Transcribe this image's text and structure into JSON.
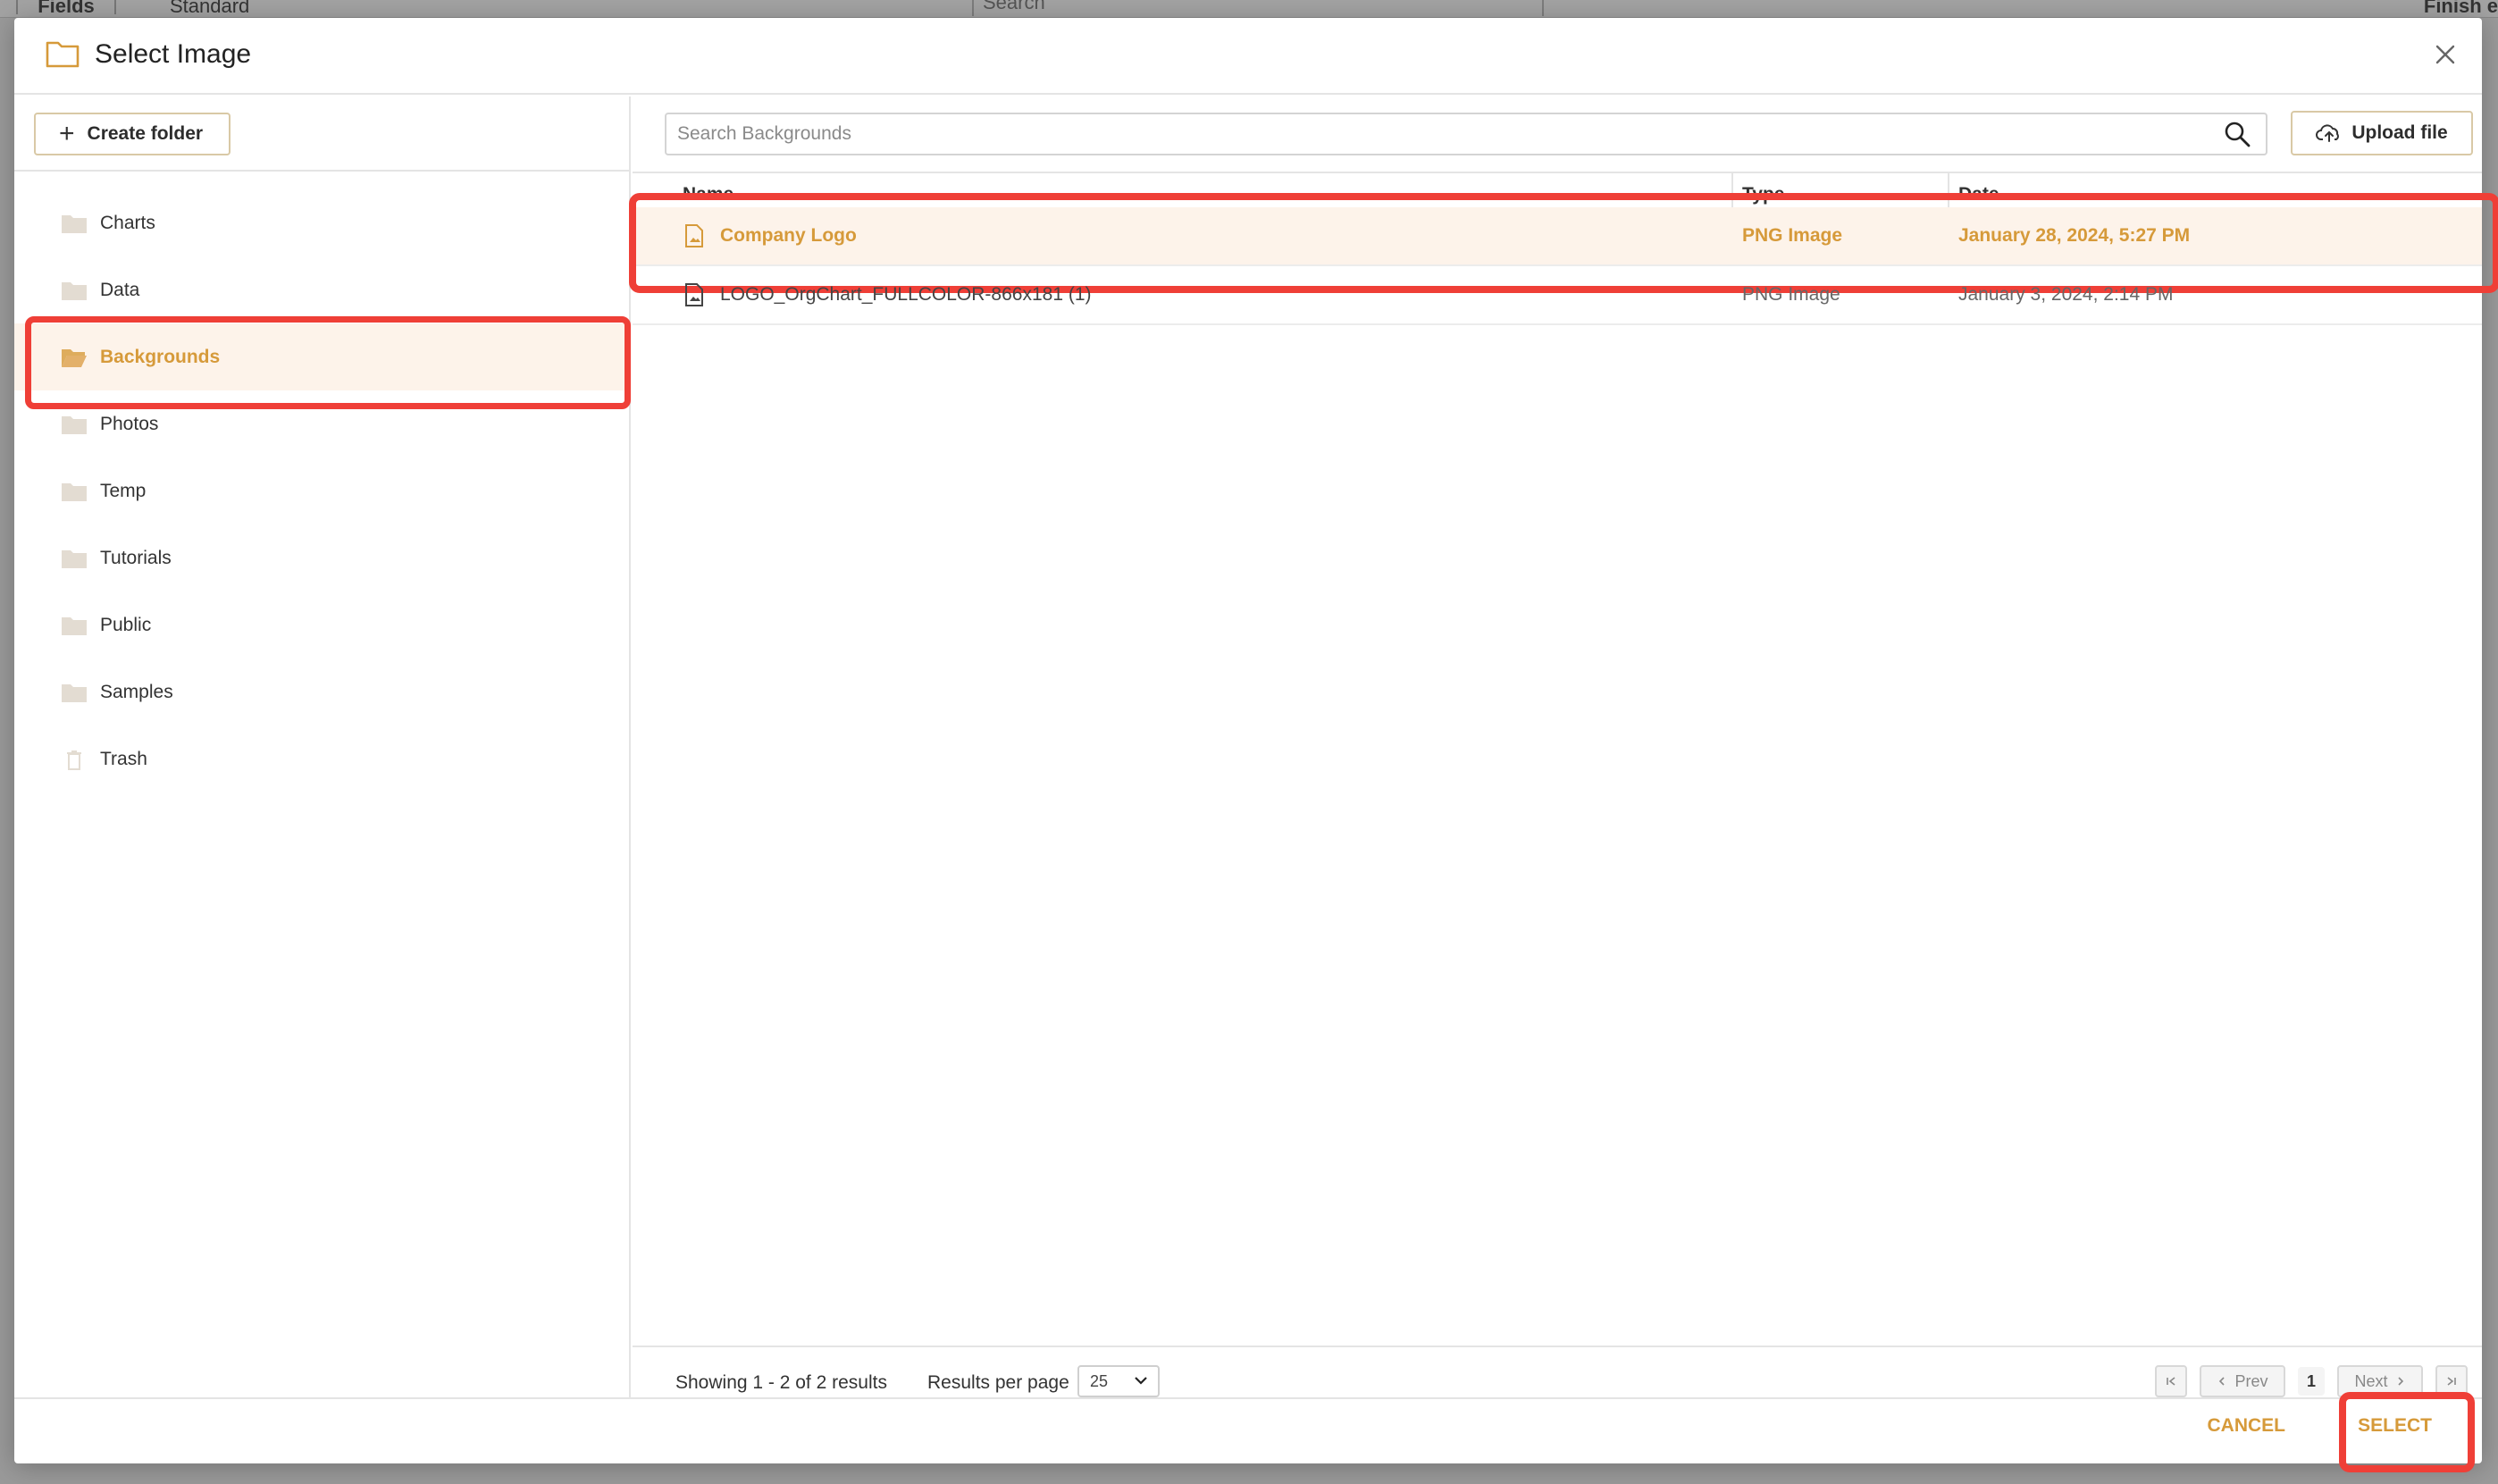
{
  "background_app": {
    "fields_tab": "Fields",
    "view_select": "Standard",
    "search_placeholder": "Search",
    "finish_label": "Finish e"
  },
  "dialog": {
    "title": "Select Image",
    "create_folder_label": "Create folder",
    "search_placeholder": "Search Backgrounds",
    "upload_label": "Upload file",
    "cancel_label": "CANCEL",
    "select_label": "SELECT"
  },
  "folders": [
    {
      "label": "Charts",
      "icon": "folder-icon",
      "active": false
    },
    {
      "label": "Data",
      "icon": "folder-icon",
      "active": false
    },
    {
      "label": "Backgrounds",
      "icon": "folder-open-icon",
      "active": true
    },
    {
      "label": "Photos",
      "icon": "folder-icon",
      "active": false
    },
    {
      "label": "Temp",
      "icon": "folder-icon",
      "active": false
    },
    {
      "label": "Tutorials",
      "icon": "folder-icon",
      "active": false
    },
    {
      "label": "Public",
      "icon": "folder-icon",
      "active": false
    },
    {
      "label": "Samples",
      "icon": "folder-icon",
      "active": false
    },
    {
      "label": "Trash",
      "icon": "trash-icon",
      "active": false
    }
  ],
  "table": {
    "columns": [
      "Name",
      "Type",
      "Date"
    ],
    "rows": [
      {
        "name": "Company Logo",
        "type": "PNG Image",
        "date": "January 28, 2024, 5:27 PM",
        "selected": true
      },
      {
        "name": "LOGO_OrgChart_FULLCOLOR-866x181 (1)",
        "type": "PNG Image",
        "date": "January 3, 2024, 2:14 PM",
        "selected": false
      }
    ]
  },
  "pagination": {
    "showing": "Showing 1 - 2 of 2 results",
    "results_per_page_label": "Results per page",
    "per_page_value": "25",
    "prev_label": "Prev",
    "next_label": "Next",
    "current_page": "1"
  },
  "colors": {
    "accent": "#d69a3a",
    "selected_bg": "#fdf3ea",
    "highlight": "#ef3f37"
  }
}
